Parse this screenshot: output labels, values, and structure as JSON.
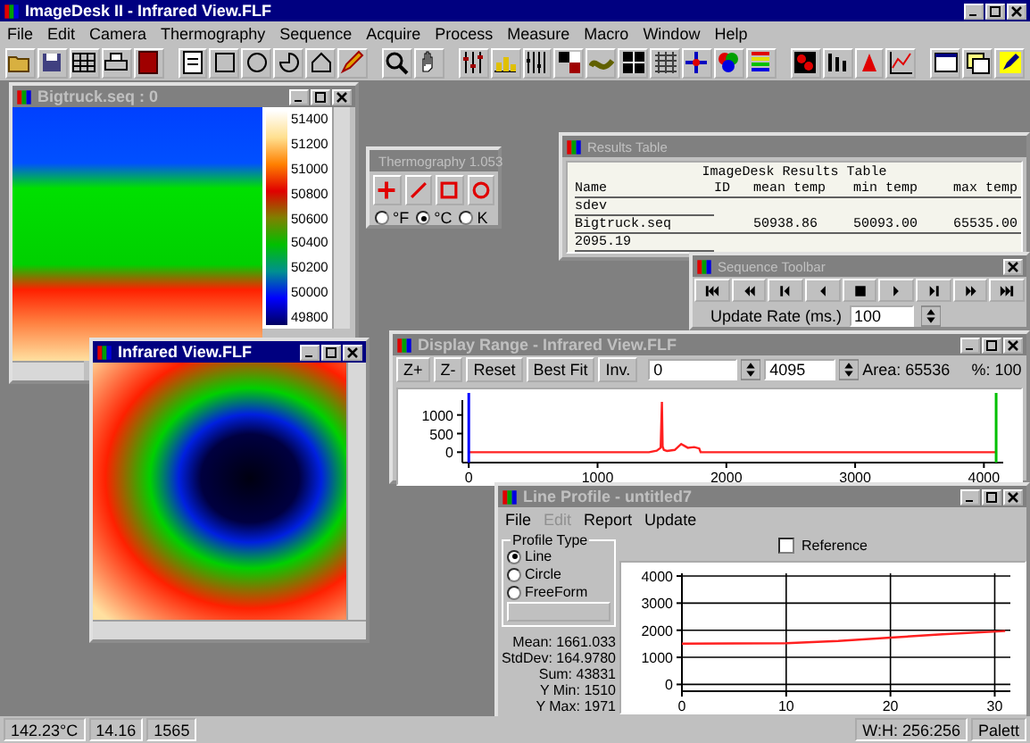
{
  "window": {
    "title": "ImageDesk II - Infrared View.FLF",
    "active": true
  },
  "menu": [
    "File",
    "Edit",
    "Camera",
    "Thermography",
    "Sequence",
    "Acquire",
    "Process",
    "Measure",
    "Macro",
    "Window",
    "Help"
  ],
  "sequence_image_window": {
    "title": "Bigtruck.seq : 0",
    "active": false,
    "scale_labels": [
      "51400",
      "51200",
      "51000",
      "50800",
      "50600",
      "50400",
      "50200",
      "50000",
      "49800"
    ]
  },
  "thermography_toolbar": {
    "title": "Thermography 1.053",
    "active": false,
    "units": [
      {
        "label": "°F",
        "selected": false
      },
      {
        "label": "°C",
        "selected": true
      },
      {
        "label": "K",
        "selected": false
      }
    ]
  },
  "results_table": {
    "title": "Results Table",
    "active": false,
    "heading": "ImageDesk Results Table",
    "columns": [
      "Name",
      "ID",
      "mean temp",
      "min temp",
      "max temp",
      "sdev"
    ],
    "rows": [
      {
        "name": "Bigtruck.seq",
        "mean_temp": "50938.86",
        "min_temp": "50093.00",
        "max_temp": "65535.00",
        "sdev": "2095.19"
      }
    ]
  },
  "sequence_toolbar": {
    "title": "Sequence Toolbar",
    "active": false,
    "update_label": "Update Rate (ms.)",
    "update_value": "100"
  },
  "infrared_window": {
    "title": "Infrared View.FLF",
    "active": true
  },
  "display_range": {
    "title": "Display Range - Infrared View.FLF",
    "active": false,
    "buttons": [
      "Z+",
      "Z-",
      "Reset",
      "Best Fit",
      "Inv."
    ],
    "min_value": "0",
    "max_value": "4095",
    "area": "Area: 65536",
    "percent": "%: 100",
    "chart_data": {
      "type": "line",
      "x": [
        0,
        1400,
        1460,
        1490,
        1500,
        1505,
        1515,
        1540,
        1600,
        1650,
        1700,
        1750,
        1790,
        1800,
        4095
      ],
      "xlim": [
        -50,
        4150
      ],
      "ylim": [
        -280,
        1400
      ],
      "xticks": [
        0,
        1000,
        2000,
        3000,
        4000
      ],
      "yticks": [
        0,
        500,
        1000
      ],
      "series": [
        {
          "color": "#ff2020",
          "values": [
            0,
            0,
            40,
            120,
            1350,
            150,
            60,
            30,
            60,
            220,
            120,
            140,
            100,
            0,
            0
          ]
        }
      ]
    }
  },
  "line_profile": {
    "title": "Line Profile - untitled7",
    "active": false,
    "menu": [
      {
        "label": "File",
        "disabled": false
      },
      {
        "label": "Edit",
        "disabled": true
      },
      {
        "label": "Report",
        "disabled": false
      },
      {
        "label": "Update",
        "disabled": false
      }
    ],
    "profile_type": {
      "title": "Profile Type",
      "options": [
        {
          "label": "Line",
          "selected": true
        },
        {
          "label": "Circle",
          "selected": false
        },
        {
          "label": "FreeForm",
          "selected": false
        }
      ]
    },
    "stats": [
      "Mean: 1661.033",
      "StdDev: 164.9780",
      "Sum: 43831",
      "Y Min: 1510",
      "Y Max: 1971"
    ],
    "reference": {
      "label": "Reference",
      "checked": false
    },
    "chart_data": {
      "type": "line",
      "grid": true,
      "x": [
        0,
        10,
        15,
        20,
        25,
        31
      ],
      "xlim": [
        0,
        31.5
      ],
      "ylim": [
        -250,
        4100
      ],
      "xticks": [
        0,
        10,
        20,
        30
      ],
      "yticks": [
        0,
        1000,
        2000,
        3000,
        4000
      ],
      "series": [
        {
          "color": "#ff2020",
          "values": [
            1500,
            1520,
            1600,
            1730,
            1850,
            1970
          ]
        }
      ]
    }
  },
  "status_bar": [
    "142.23°C",
    "14.16",
    "1565",
    "W:H: 256:256",
    "Palett"
  ]
}
